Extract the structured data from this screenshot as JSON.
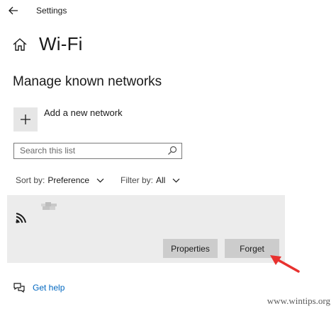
{
  "titlebar": {
    "title": "Settings",
    "back_icon": "back-arrow-icon"
  },
  "header": {
    "title": "Wi-Fi",
    "icon": "home-icon"
  },
  "section": {
    "title": "Manage known networks"
  },
  "add_network": {
    "label": "Add a new network",
    "icon": "plus-icon"
  },
  "search": {
    "placeholder": "Search this list",
    "value": "",
    "icon": "search-icon"
  },
  "sort": {
    "label": "Sort by:",
    "value": "Preference"
  },
  "filter": {
    "label": "Filter by:",
    "value": "All"
  },
  "network": {
    "name": "",
    "icon": "wifi-signal-icon",
    "properties_label": "Properties",
    "forget_label": "Forget"
  },
  "help": {
    "label": "Get help",
    "icon": "help-chat-icon"
  },
  "watermark": "www.wintips.org",
  "colors": {
    "accent": "#0067c0",
    "annotation_arrow": "#e8312f",
    "card_bg": "#ececec",
    "button_bg": "#cccccc"
  }
}
